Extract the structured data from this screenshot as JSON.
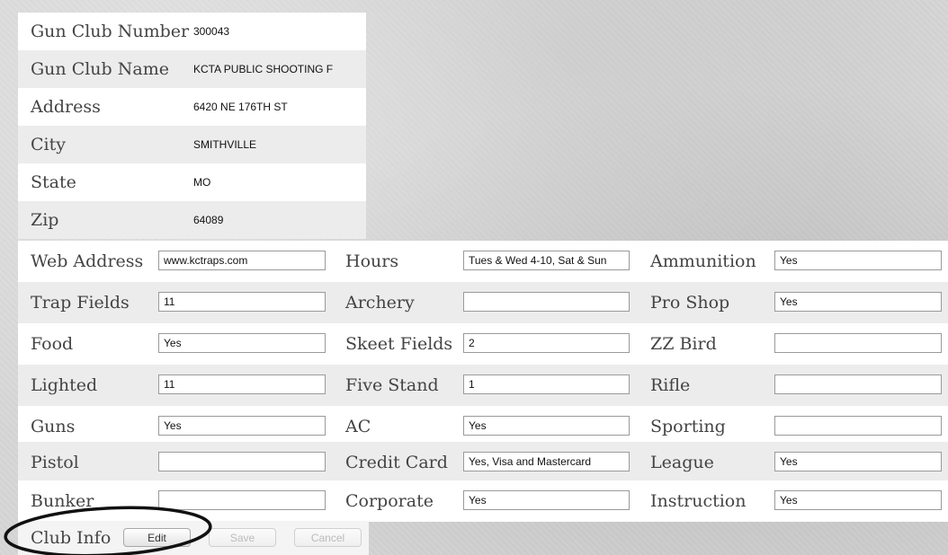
{
  "club_info": {
    "rows": [
      {
        "label": "Gun Club Number",
        "value": "300043"
      },
      {
        "label": "Gun Club Name",
        "value": "KCTA PUBLIC SHOOTING F"
      },
      {
        "label": "Address",
        "value": "6420 NE 176TH ST"
      },
      {
        "label": "City",
        "value": "SMITHVILLE"
      },
      {
        "label": "State",
        "value": "MO"
      },
      {
        "label": "Zip",
        "value": "64089"
      }
    ]
  },
  "details": {
    "rows": [
      [
        {
          "label": "Web Address",
          "value": "www.kctraps.com"
        },
        {
          "label": "Hours",
          "value": "Tues & Wed 4-10, Sat & Sun"
        },
        {
          "label": "Ammunition",
          "value": "Yes"
        }
      ],
      [
        {
          "label": "Trap Fields",
          "value": "11"
        },
        {
          "label": "Archery",
          "value": ""
        },
        {
          "label": "Pro Shop",
          "value": "Yes"
        }
      ],
      [
        {
          "label": "Food",
          "value": "Yes"
        },
        {
          "label": "Skeet Fields",
          "value": "2"
        },
        {
          "label": "ZZ Bird",
          "value": ""
        }
      ],
      [
        {
          "label": "Lighted",
          "value": "11"
        },
        {
          "label": "Five Stand",
          "value": "1"
        },
        {
          "label": "Rifle",
          "value": ""
        }
      ],
      [
        {
          "label": "Guns",
          "value": "Yes"
        },
        {
          "label": "AC",
          "value": "Yes"
        },
        {
          "label": "Sporting",
          "value": ""
        }
      ],
      [
        {
          "label": "Pistol",
          "value": ""
        },
        {
          "label": "Credit Card",
          "value": "Yes, Visa and Mastercard"
        },
        {
          "label": "League",
          "value": "Yes"
        }
      ],
      [
        {
          "label": "Bunker",
          "value": ""
        },
        {
          "label": "Corporate",
          "value": "Yes"
        },
        {
          "label": "Instruction",
          "value": "Yes"
        }
      ]
    ]
  },
  "bottom_bar": {
    "label": "Club Info",
    "edit": "Edit",
    "save": "Save",
    "cancel": "Cancel"
  }
}
